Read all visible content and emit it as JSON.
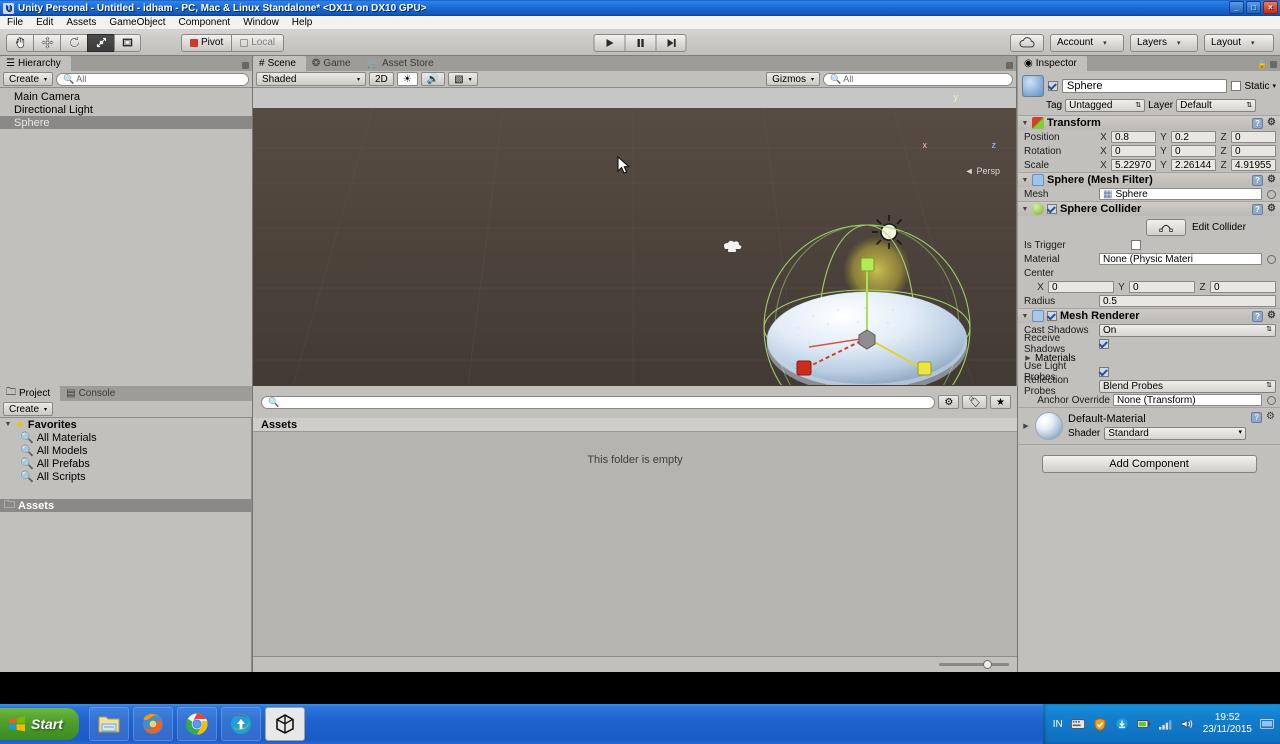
{
  "window": {
    "title": "Unity Personal - Untitled - idham - PC, Mac & Linux Standalone* <DX11 on DX10 GPU>",
    "icon": "unity-icon",
    "minimize": "_",
    "maximize": "□",
    "close": "×"
  },
  "menubar": {
    "items": [
      "File",
      "Edit",
      "Assets",
      "GameObject",
      "Component",
      "Window",
      "Help"
    ]
  },
  "toolbar": {
    "transform_tools": [
      {
        "name": "hand-tool",
        "selected": false
      },
      {
        "name": "move-tool",
        "selected": false
      },
      {
        "name": "rotate-tool",
        "selected": false
      },
      {
        "name": "scale-tool",
        "selected": true
      },
      {
        "name": "rect-tool",
        "selected": false
      }
    ],
    "pivot_label": "Pivot",
    "local_label": "Local",
    "play_label": "▶",
    "pause_label": "❚❚",
    "step_label": "▶❙",
    "cloud_label": "cloud-icon",
    "account_label": "Account",
    "layers_label": "Layers",
    "layout_label": "Layout",
    "caret": "▾"
  },
  "hierarchy": {
    "tab_label": "Hierarchy",
    "create_label": "Create",
    "search_placeholder": "All",
    "search_value": "",
    "items": [
      {
        "label": "Main Camera",
        "selected": false
      },
      {
        "label": "Directional Light",
        "selected": false
      },
      {
        "label": "Sphere",
        "selected": true
      }
    ]
  },
  "scene": {
    "tabs": [
      {
        "label": "Scene",
        "icon": "scene-icon",
        "active": true
      },
      {
        "label": "Game",
        "icon": "game-icon",
        "active": false
      },
      {
        "label": "Asset Store",
        "icon": "store-icon",
        "active": false
      }
    ],
    "shading_label": "Shaded",
    "mode_2d_label": "2D",
    "lighting_icon": "lighting-icon",
    "audio_icon": "audio-icon",
    "effects_icon": "effects-icon",
    "gizmos_label": "Gizmos",
    "search_placeholder": "All",
    "search_value": "",
    "axis_gizmo": {
      "x": "x",
      "y": "y",
      "z": "z",
      "mode": "Persp"
    },
    "objects": [
      "directional-light-gizmo",
      "camera-gizmo",
      "sphere-mesh",
      "scale-gizmo",
      "collider-wireframe"
    ]
  },
  "project": {
    "tabs": [
      {
        "label": "Project",
        "icon": "project-icon",
        "active": true
      },
      {
        "label": "Console",
        "icon": "console-icon",
        "active": false
      }
    ],
    "create_label": "Create",
    "search_placeholder": "",
    "favorites_label": "Favorites",
    "favorites": [
      "All Materials",
      "All Models",
      "All Prefabs",
      "All Scripts"
    ],
    "assets_label": "Assets",
    "content_header": "Assets",
    "empty_message": "This folder is empty"
  },
  "inspector": {
    "tab_label": "Inspector",
    "object_name": "Sphere",
    "enabled": true,
    "static_label": "Static",
    "static_checked": false,
    "tag_label": "Tag",
    "tag_value": "Untagged",
    "layer_label": "Layer",
    "layer_value": "Default",
    "transform": {
      "title": "Transform",
      "position_label": "Position",
      "position": {
        "x": "0.8",
        "y": "0.2",
        "z": "0"
      },
      "rotation_label": "Rotation",
      "rotation": {
        "x": "0",
        "y": "0",
        "z": "0"
      },
      "scale_label": "Scale",
      "scale": {
        "x": "5.22970",
        "y": "2.26144",
        "z": "4.91955"
      }
    },
    "mesh_filter": {
      "title": "Sphere (Mesh Filter)",
      "mesh_label": "Mesh",
      "mesh_value": "Sphere"
    },
    "sphere_collider": {
      "title": "Sphere Collider",
      "enabled": true,
      "edit_collider_label": "Edit Collider",
      "is_trigger_label": "Is Trigger",
      "is_trigger_checked": false,
      "material_label": "Material",
      "material_value": "None (Physic Materi",
      "center_label": "Center",
      "center": {
        "x": "0",
        "y": "0",
        "z": "0"
      },
      "radius_label": "Radius",
      "radius_value": "0.5"
    },
    "mesh_renderer": {
      "title": "Mesh Renderer",
      "enabled": true,
      "cast_shadows_label": "Cast Shadows",
      "cast_shadows_value": "On",
      "receive_shadows_label": "Receive Shadows",
      "receive_shadows_checked": true,
      "materials_label": "Materials",
      "light_probes_label": "Use Light Probes",
      "light_probes_checked": true,
      "reflection_probes_label": "Reflection Probes",
      "reflection_probes_value": "Blend Probes",
      "anchor_override_label": "Anchor Override",
      "anchor_override_value": "None (Transform)"
    },
    "material": {
      "title": "Default-Material",
      "shader_label": "Shader",
      "shader_value": "Standard"
    },
    "add_component_label": "Add Component"
  },
  "taskbar": {
    "start_label": "Start",
    "quick_launch": [
      {
        "name": "explorer-icon",
        "active": false
      },
      {
        "name": "firefox-icon",
        "active": false
      },
      {
        "name": "chrome-icon",
        "active": false
      },
      {
        "name": "idm-icon",
        "active": false
      },
      {
        "name": "unity-icon",
        "active": true
      }
    ],
    "tray_lang": "IN",
    "tray_icons": [
      "keyboard-icon",
      "shield-icon",
      "download-icon",
      "battery-icon",
      "network-icon",
      "volume-icon"
    ],
    "time": "19:52",
    "date": "23/11/2015",
    "show_desktop": "desktop-icon"
  },
  "colors": {
    "accent_blue": "#1059be",
    "panel_gray": "#c2c0bc",
    "axis_x": "#c82a22",
    "axis_y": "#8ccc3a",
    "axis_z": "#e0d83a",
    "selection": "#8b8987"
  }
}
